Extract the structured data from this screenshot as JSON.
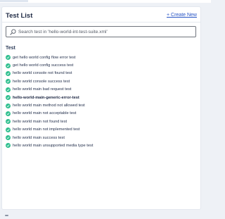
{
  "panel": {
    "title": "Test List",
    "create_link": "+ Create New"
  },
  "search": {
    "placeholder": "Search test in 'hello-world-int-test-suite.xml'"
  },
  "section": {
    "label": "Test"
  },
  "tests": [
    {
      "name": "get hello world config flow error test",
      "status": "passed"
    },
    {
      "name": "get hello world config success test",
      "status": "passed"
    },
    {
      "name": "hello world console not found test",
      "status": "passed"
    },
    {
      "name": "hello world console success test",
      "status": "passed"
    },
    {
      "name": "hello world main bad request test",
      "status": "passed"
    },
    {
      "name": "hello-world-main-generic-error-test",
      "status": "passed",
      "active": true
    },
    {
      "name": "hello world main method not allowed test",
      "status": "passed"
    },
    {
      "name": "hello world main not acceptable test",
      "status": "passed"
    },
    {
      "name": "hello world main not found test",
      "status": "passed"
    },
    {
      "name": "hello world main not implemented test",
      "status": "passed"
    },
    {
      "name": "hello world main success test",
      "status": "passed"
    },
    {
      "name": "hello world main unsupported media type test",
      "status": "passed"
    }
  ],
  "colors": {
    "status_passed": "#2fbf8f",
    "link": "#2855c5"
  }
}
